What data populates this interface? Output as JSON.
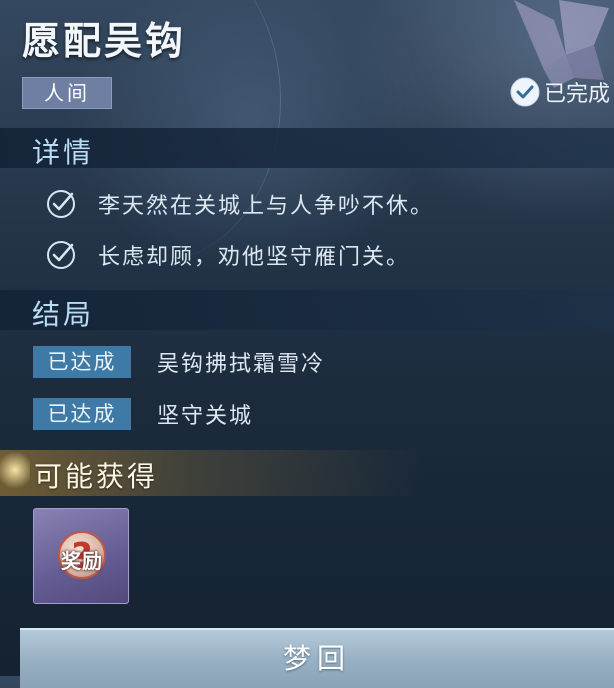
{
  "header": {
    "title": "愿配吴钩",
    "tag": "人间",
    "status": "已完成"
  },
  "details": {
    "title": "详情",
    "items": [
      "李天然在关城上与人争吵不休。",
      "长虑却顾，劝他坚守雁门关。"
    ]
  },
  "ending": {
    "title": "结局",
    "items": [
      {
        "badge": "已达成",
        "text": "吴钩拂拭霜雪冷"
      },
      {
        "badge": "已达成",
        "text": "坚守关城"
      }
    ]
  },
  "rewards": {
    "title": "可能获得",
    "item_label": "奖励"
  },
  "button": {
    "label": "梦回"
  },
  "colors": {
    "accent_blue": "#3e7aa5",
    "section_text": "#b9dcf3",
    "tag_bg": "#6f7fa2",
    "reward_gold": "#786234"
  },
  "icons": {
    "status": "check-circle-icon",
    "detail": "check-icon",
    "reward": "question-medal-icon",
    "corner": "wing-emblem-icon"
  }
}
